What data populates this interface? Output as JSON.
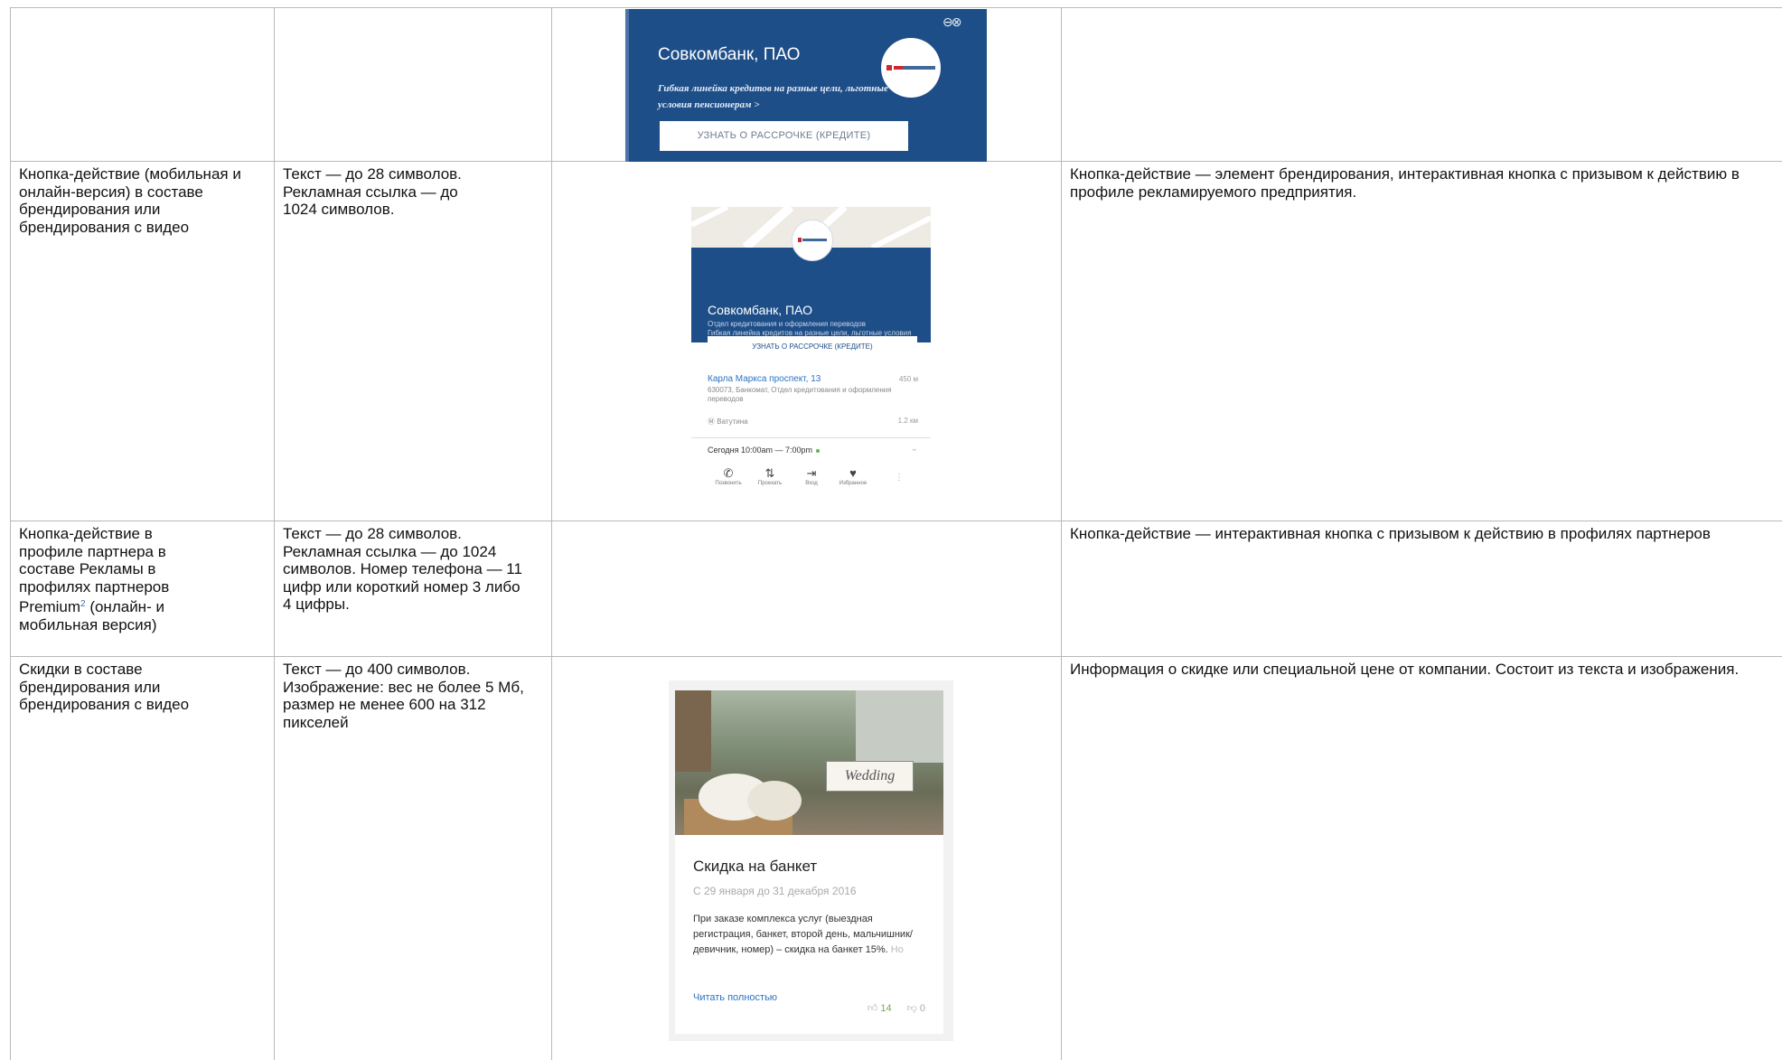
{
  "rows": [
    {
      "name": "Кнопка-действие (мобильная и онлайн-версия) в составе брендирования или брендирования с видео",
      "requirements": "Текст — до 28 символов. Рекламная ссылка — до 1024 символов.",
      "description": "Кнопка-действие — элемент брендирования, интерактивная кнопка с призывом к действию в профиле рекламируемого предприятия."
    },
    {
      "name_lines": [
        "Кнопка-действие в",
        "профиле партнера в",
        "составе Рекламы в",
        "профилях партнеров"
      ],
      "name_premium": "Premium",
      "name_footnote": "2",
      "name_rest": "(онлайн- и",
      "name_last": "мобильная версия)",
      "requirements": "Текст — до 28 символов. Рекламная ссылка — до 1024 символов. Номер телефона — 11 цифр или короткий номер 3 либо 4 цифры.",
      "description": "Кнопка-действие — интерактивная кнопка с призывом к действию в профилях партнеров"
    },
    {
      "name": "Скидки в составе брендирования или брендирования с видео",
      "requirements": "Текст — до 400 символов. Изображение: вес не более 5 Мб, размер не менее 600 на 312 пикселей",
      "description": "Информация о скидке или специальной цене от компании. Состоит из текста и изображения."
    }
  ],
  "banner_top": {
    "title": "Совкомбанк, ПАО",
    "slogan": "Гибкая линейка кредитов на разные цели, льготные условия пенсионерам",
    "slogan_arrow": ">",
    "button": "УЗНАТЬ О РАССРОЧКЕ (КРЕДИТЕ)",
    "close_icon": "minus-close-icon"
  },
  "mobile_card": {
    "name": "Совкомбанк, ПАО",
    "subtitle": "Отдел кредитования и оформления переводов",
    "promo": "Гибкая линейка кредитов на разные цели, льготные условия пенсионерам - подробнее",
    "button": "УЗНАТЬ О РАССРОЧКЕ (КРЕДИТЕ)",
    "address": "Карла Маркса проспект, 13",
    "address_distance": "450 м",
    "address_details": "630073, Банкомат, Отдел кредитования и оформления переводов",
    "metro": "Ватутина",
    "metro_distance": "1.2 км",
    "hours": "Сегодня 10:00am — 7:00pm",
    "actions": [
      {
        "icon": "phone-icon",
        "label": "Позвонить"
      },
      {
        "icon": "route-icon",
        "label": "Проехать"
      },
      {
        "icon": "entrance-icon",
        "label": "Вход"
      },
      {
        "icon": "heart-icon",
        "label": "Избранное"
      }
    ]
  },
  "discount_card": {
    "sign_text": "Wedding",
    "title": "Скидка на банкет",
    "dates": "С 29 января до 31 декабря 2016",
    "text": "При заказе комплекса услуг (выездная регистрация, банкет, второй день, мальчишник/девичник, номер) – скидка на банкет 15%.",
    "text_fade": "Но",
    "read_more": "Читать полностью",
    "likes": "14",
    "dislikes": "0"
  },
  "colors": {
    "brand_blue": "#1e4e88",
    "link_blue": "#2b73c2",
    "grid_line": "#b9b9b9"
  }
}
